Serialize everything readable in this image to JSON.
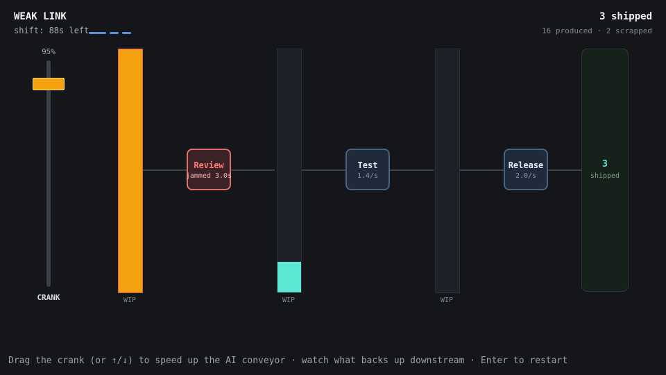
{
  "header": {
    "title": "WEAK LINK",
    "shift_text": "shift: 88s left",
    "shipped_text": "3 shipped",
    "stats_text": "16 produced · 2 scrapped"
  },
  "crank": {
    "percent_text": "95%",
    "level": 0.95,
    "label": "CRANK",
    "color": "#f5a00f"
  },
  "buffers": [
    {
      "label": "WIP",
      "fill_fraction": 1.0,
      "fill_color": "#f5a00f"
    },
    {
      "label": "WIP",
      "fill_fraction": 0.125,
      "fill_color": "#5ee8d4"
    },
    {
      "label": "WIP",
      "fill_fraction": 0.0,
      "fill_color": "#5ee8d4"
    }
  ],
  "stages": [
    {
      "name": "Review",
      "status": "jammed 3.0s",
      "state": "jammed",
      "color": "#ff7b72"
    },
    {
      "name": "Test",
      "status": "1.4/s",
      "state": "ok"
    },
    {
      "name": "Release",
      "status": "2.0/s",
      "state": "ok"
    }
  ],
  "output_bin": {
    "count": "3",
    "label": "shipped"
  },
  "footer": {
    "hint": "Drag the crank (or ↑/↓) to speed up the AI conveyor · watch what backs up downstream · Enter to restart"
  }
}
